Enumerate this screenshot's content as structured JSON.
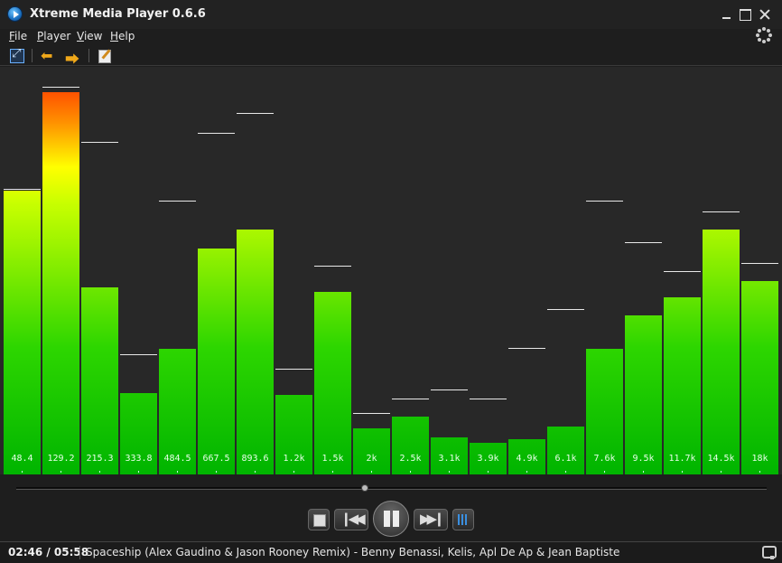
{
  "window": {
    "title": "Xtreme Media Player 0.6.6"
  },
  "menu": {
    "items": [
      {
        "label": "File",
        "key": "F",
        "rest": "ile"
      },
      {
        "label": "Player",
        "key": "P",
        "rest": "layer"
      },
      {
        "label": "View",
        "key": "V",
        "rest": "iew"
      },
      {
        "label": "Help",
        "key": "H",
        "rest": "elp"
      }
    ]
  },
  "toolbar": {
    "icons": [
      "fullscreen-icon",
      "arrow-left-icon",
      "arrow-right-icon",
      "edit-icon"
    ]
  },
  "visualizer": {
    "levels_max": 451,
    "bands": [
      {
        "freq": "48.4",
        "level": 314,
        "peak": 314
      },
      {
        "freq": "129.2",
        "level": 423,
        "peak": 427
      },
      {
        "freq": "215.3",
        "level": 207,
        "peak": 366
      },
      {
        "freq": "333.8",
        "level": 90,
        "peak": 131
      },
      {
        "freq": "484.5",
        "level": 139,
        "peak": 301
      },
      {
        "freq": "667.5",
        "level": 250,
        "peak": 376
      },
      {
        "freq": "893.6",
        "level": 271,
        "peak": 398
      },
      {
        "freq": "1.2k",
        "level": 88,
        "peak": 115
      },
      {
        "freq": "1.5k",
        "level": 202,
        "peak": 229
      },
      {
        "freq": "2k",
        "level": 51,
        "peak": 66
      },
      {
        "freq": "2.5k",
        "level": 64,
        "peak": 82
      },
      {
        "freq": "3.1k",
        "level": 41,
        "peak": 92
      },
      {
        "freq": "3.9k",
        "level": 35,
        "peak": 82
      },
      {
        "freq": "4.9k",
        "level": 39,
        "peak": 138
      },
      {
        "freq": "6.1k",
        "level": 53,
        "peak": 181
      },
      {
        "freq": "7.6k",
        "level": 139,
        "peak": 301
      },
      {
        "freq": "9.5k",
        "level": 176,
        "peak": 255
      },
      {
        "freq": "11.7k",
        "level": 196,
        "peak": 223
      },
      {
        "freq": "14.5k",
        "level": 271,
        "peak": 289
      },
      {
        "freq": "18k",
        "level": 214,
        "peak": 232
      }
    ]
  },
  "seek": {
    "position_fraction": 0.465
  },
  "controls": {
    "buttons": [
      "stop-button",
      "prev-button",
      "pause-button",
      "next-button",
      "volume-button"
    ]
  },
  "status": {
    "time": "02:46 / 05:58",
    "track": "Spaceship (Alex Gaudino & Jason Rooney Remix) - Benny Benassi, Kelis, Apl De Ap & Jean Baptiste"
  }
}
